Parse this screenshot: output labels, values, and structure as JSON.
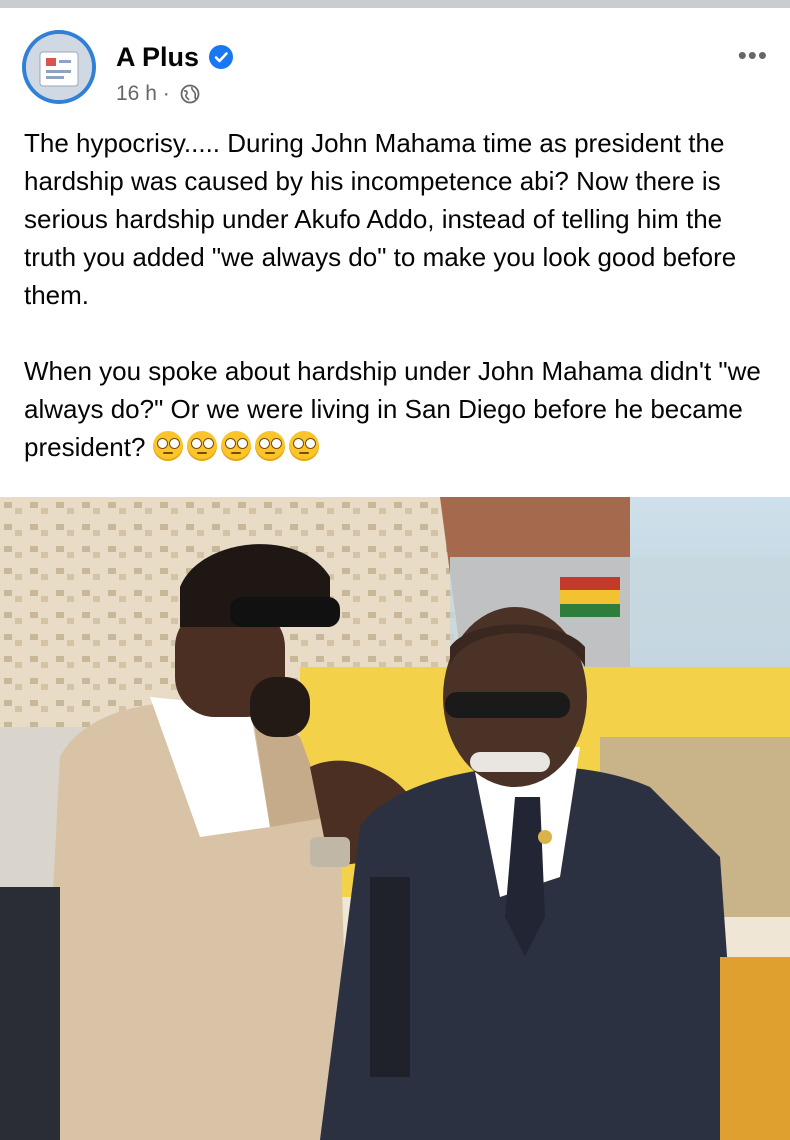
{
  "post": {
    "author": "A Plus",
    "time": "16 h",
    "separator": "·",
    "more_label": "•••",
    "paragraph1": "The hypocrisy..... During John Mahama time as president the hardship was caused by his incompetence abi? Now there is serious hardship under Akufo Addo, instead of telling him the truth you added \"we always do\" to make you look good before them.",
    "paragraph2": "When you spoke about hardship under John Mahama didn't \"we always do?\" Or we were living in San Diego before he became president?",
    "emoji_count": 5,
    "emoji_name": "face-with-rolling-eyes"
  },
  "icons": {
    "verified": "verified-badge-icon",
    "globe": "globe-icon",
    "more": "more-options-icon"
  },
  "colors": {
    "verified_blue": "#1877f2",
    "meta_grey": "#65676b",
    "text": "#050505"
  }
}
